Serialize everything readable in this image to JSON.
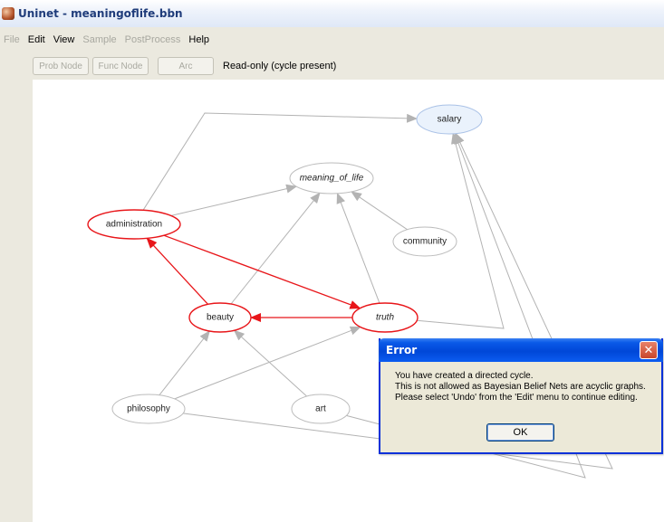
{
  "window": {
    "title": "Uninet - meaningoflife.bbn",
    "icon": "uninet-app-icon"
  },
  "menu": [
    {
      "label": "File",
      "enabled": false
    },
    {
      "label": "Edit",
      "enabled": true
    },
    {
      "label": "View",
      "enabled": true
    },
    {
      "label": "Sample",
      "enabled": false
    },
    {
      "label": "PostProcess",
      "enabled": false
    },
    {
      "label": "Help",
      "enabled": true
    }
  ],
  "toolbar": {
    "prob_node_label": "Prob Node",
    "func_node_label": "Func Node",
    "arc_label": "Arc",
    "status": "Read-only (cycle present)"
  },
  "graph": {
    "nodes": [
      {
        "id": "salary",
        "label": "salary",
        "italic": false,
        "state": "selected"
      },
      {
        "id": "meaning_of_life",
        "label": "meaning_of_life",
        "italic": true,
        "state": "normal"
      },
      {
        "id": "administration",
        "label": "administration",
        "italic": false,
        "state": "cycle"
      },
      {
        "id": "community",
        "label": "community",
        "italic": false,
        "state": "normal"
      },
      {
        "id": "beauty",
        "label": "beauty",
        "italic": false,
        "state": "cycle"
      },
      {
        "id": "truth",
        "label": "truth",
        "italic": true,
        "state": "cycle"
      },
      {
        "id": "philosophy",
        "label": "philosophy",
        "italic": false,
        "state": "normal"
      },
      {
        "id": "art",
        "label": "art",
        "italic": false,
        "state": "normal"
      }
    ],
    "arcs": [
      {
        "from": "administration",
        "to": "salary",
        "cycle": false
      },
      {
        "from": "administration",
        "to": "meaning_of_life",
        "cycle": false
      },
      {
        "from": "community",
        "to": "meaning_of_life",
        "cycle": false
      },
      {
        "from": "beauty",
        "to": "meaning_of_life",
        "cycle": false
      },
      {
        "from": "truth",
        "to": "meaning_of_life",
        "cycle": false
      },
      {
        "from": "beauty",
        "to": "administration",
        "cycle": true
      },
      {
        "from": "administration",
        "to": "truth",
        "cycle": true
      },
      {
        "from": "truth",
        "to": "beauty",
        "cycle": true
      },
      {
        "from": "philosophy",
        "to": "beauty",
        "cycle": false
      },
      {
        "from": "art",
        "to": "beauty",
        "cycle": false
      },
      {
        "from": "philosophy",
        "to": "truth",
        "cycle": false
      },
      {
        "from": "philosophy",
        "to": "salary",
        "cycle": false
      },
      {
        "from": "art",
        "to": "salary",
        "cycle": false
      },
      {
        "from": "truth",
        "to": "salary",
        "cycle": false
      }
    ],
    "colors": {
      "cycle": "#e8161a",
      "arc": "#b3b3b3",
      "selected_fill": "#eaf2fc",
      "node_stroke": "#bcbcbc"
    }
  },
  "dialog": {
    "title": "Error",
    "lines": [
      "You have created a directed cycle.",
      "This is not allowed as Bayesian Belief Nets are acyclic graphs.",
      "Please select 'Undo' from the 'Edit' menu to continue editing."
    ],
    "ok_label": "OK",
    "close_icon": "close-x-icon"
  },
  "theme": {
    "titlebar_text": "#1f3c7a",
    "dialog_titlebar": "#0a5ae8",
    "chrome_bg": "#ebe9df"
  }
}
